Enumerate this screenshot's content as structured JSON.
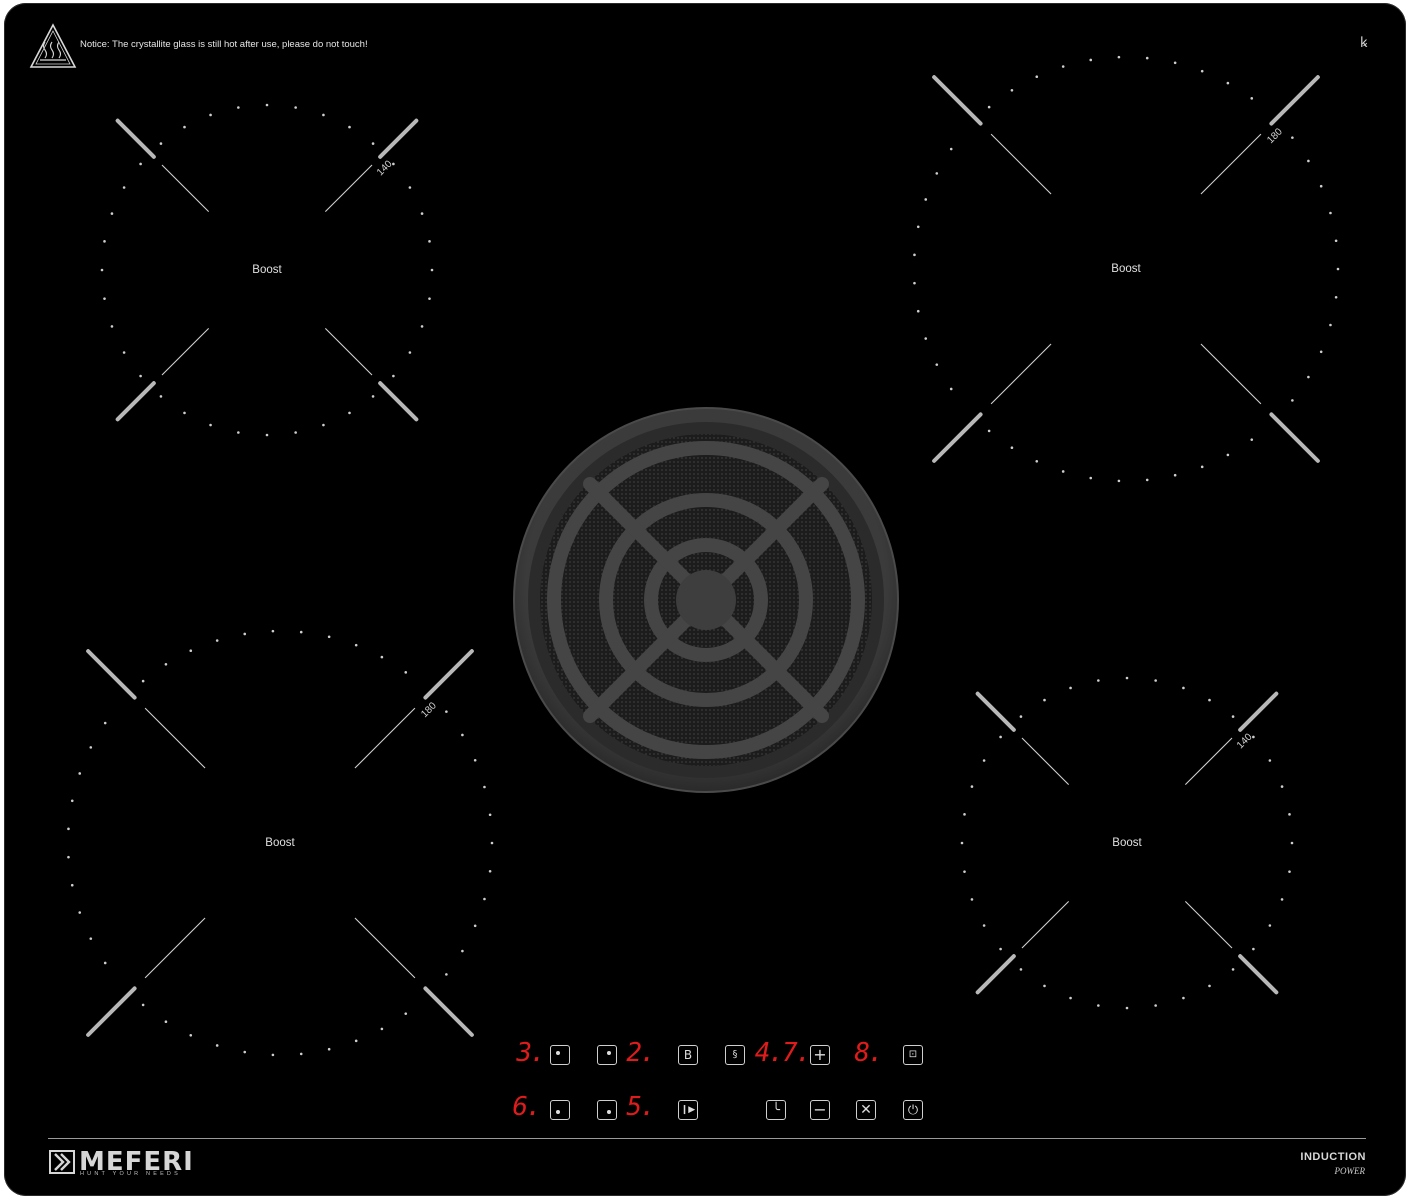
{
  "notice": {
    "text": "Notice: The crystallite glass is still hot after use, please do not touch!"
  },
  "icons": {
    "warning": "hot-surface-warning-icon",
    "corner": "lock-symbol-icon",
    "vent": "downdraft-vent-grille"
  },
  "corner_glyph": "ꝃ",
  "zones": [
    {
      "label": "Boost",
      "size": "140"
    },
    {
      "label": "Boost",
      "size": "180"
    },
    {
      "label": "Boost",
      "size": "180"
    },
    {
      "label": "Boost",
      "size": "140"
    }
  ],
  "controls": {
    "top_row": {
      "digit_1": "3.",
      "digit_2": "2.",
      "digit_3": "4.7.",
      "digit_4": "8.",
      "boost_key": "B"
    },
    "bottom_row": {
      "digit_1": "6.",
      "digit_2": "5."
    }
  },
  "brand": {
    "name": "MEFERI",
    "tagline": "HUNT YOUR NEEDS",
    "product": "INDUCTION",
    "product_sub": "POWER"
  },
  "colors": {
    "glass": "#000000",
    "display_red": "#e01b1b",
    "print_grey": "#cfcfcf"
  }
}
